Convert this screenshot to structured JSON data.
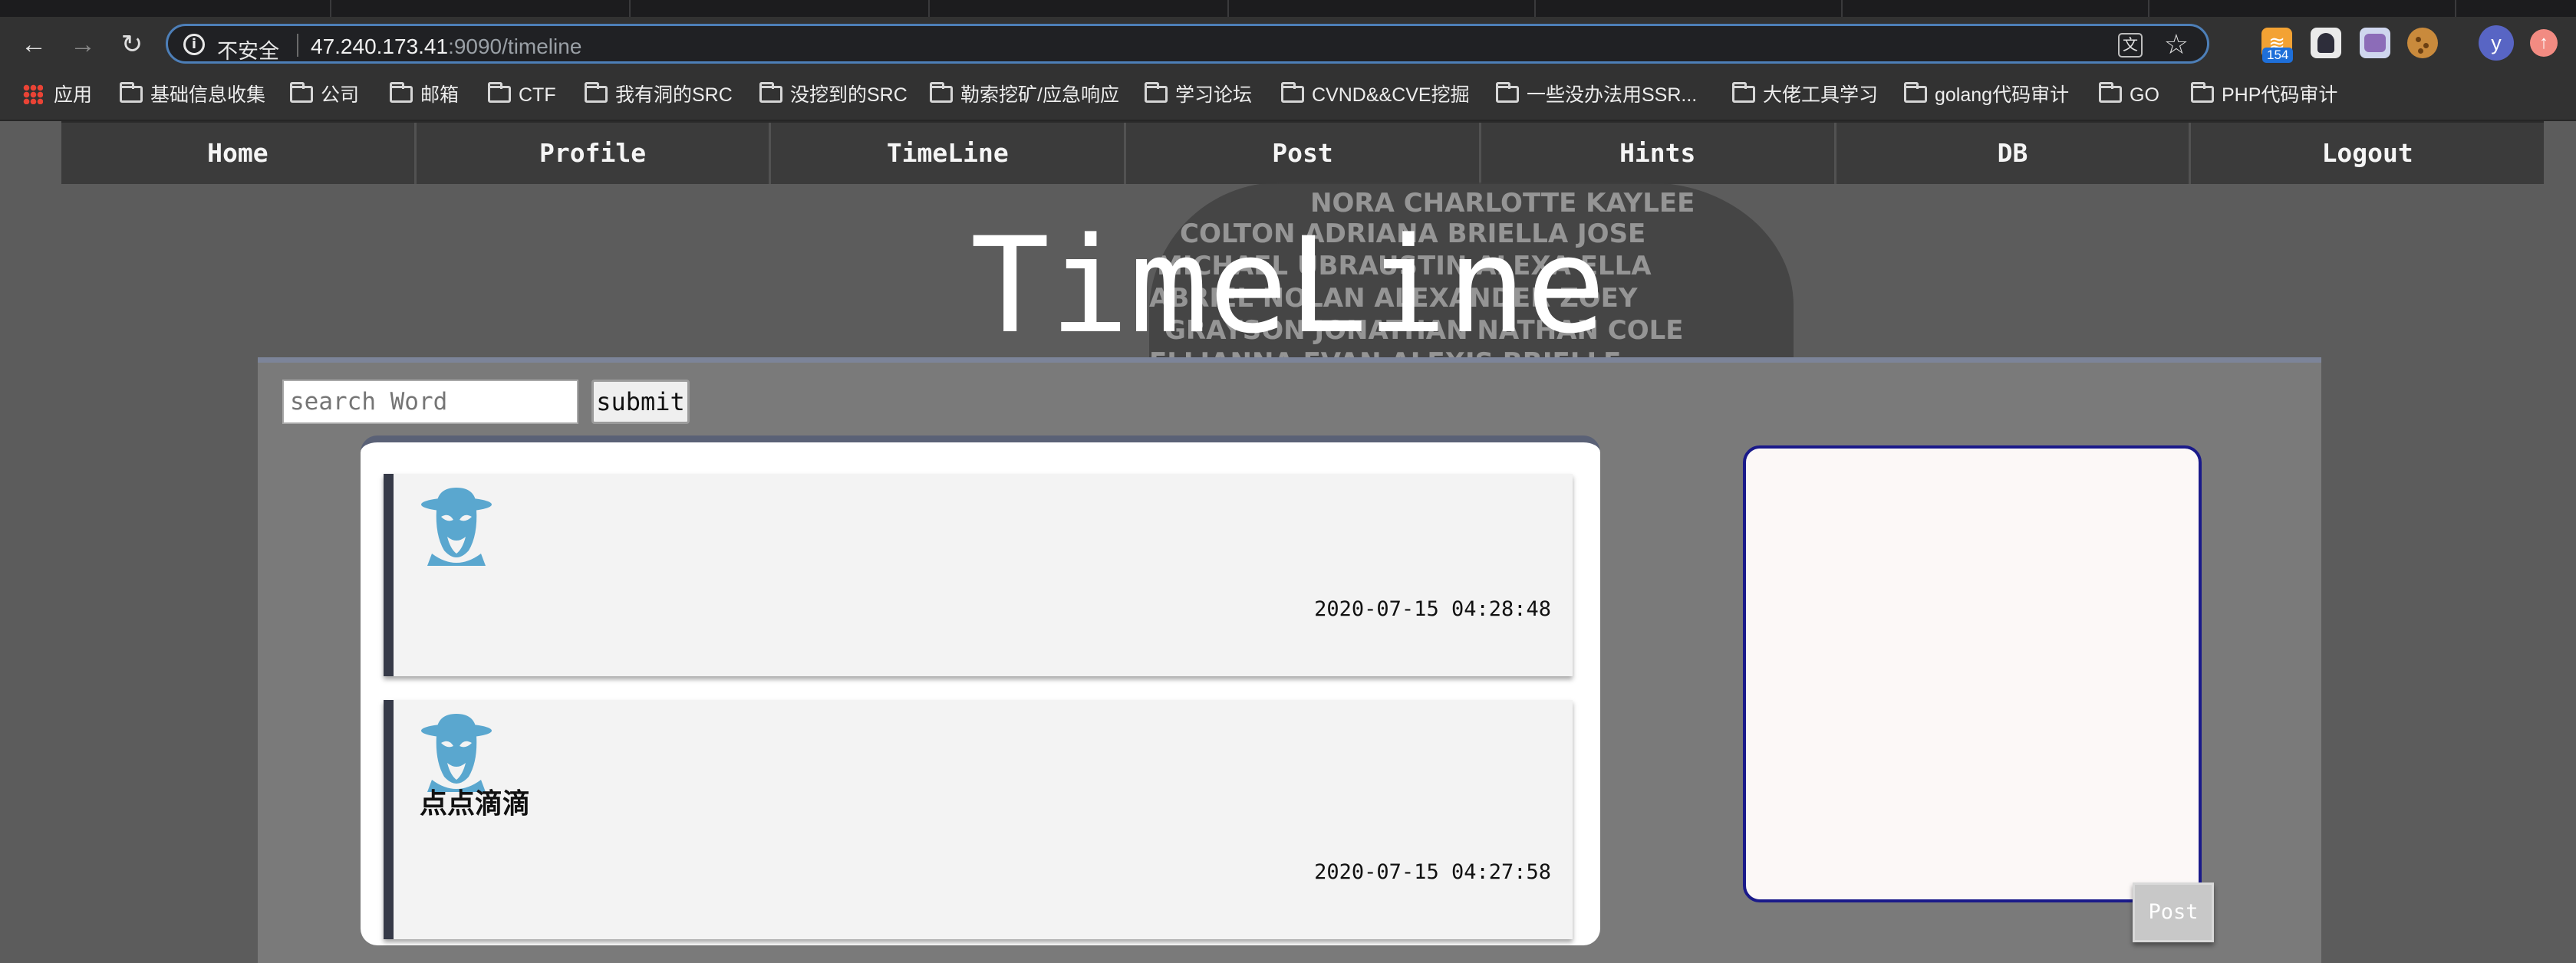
{
  "browser": {
    "address_bar": {
      "security_label": "不安全",
      "url_host": "47.240.173.41",
      "url_rest": ":9090/timeline"
    },
    "extensions": {
      "rss_badge": "154",
      "profile_initial": "y"
    },
    "bookmarks": [
      "应用",
      "基础信息收集",
      "公司",
      "邮箱",
      "CTF",
      "我有洞的SRC",
      "没挖到的SRC",
      "勒索挖矿/应急响应",
      "学习论坛",
      "CVND&&CVE挖掘",
      "一些没办法用SSR...",
      "大佬工具学习",
      "golang代码审计",
      "GO",
      "PHP代码审计"
    ]
  },
  "site": {
    "nav": [
      "Home",
      "Profile",
      "TimeLine",
      "Post",
      "Hints",
      "DB",
      "Logout"
    ],
    "title": "TimeLine",
    "search": {
      "placeholder": "search Word",
      "submit_label": "submit"
    },
    "posts": [
      {
        "text": "",
        "timestamp": "2020-07-15 04:28:48"
      },
      {
        "text": "点点滴滴",
        "timestamp": "2020-07-15 04:27:58"
      }
    ],
    "composer": {
      "post_label": "Post"
    }
  },
  "colors": {
    "nav_bg": "#3b3b3b",
    "avatar_blue": "#5aa7cf",
    "card_border": "#363a48",
    "composer_border": "#1a1a8a"
  }
}
